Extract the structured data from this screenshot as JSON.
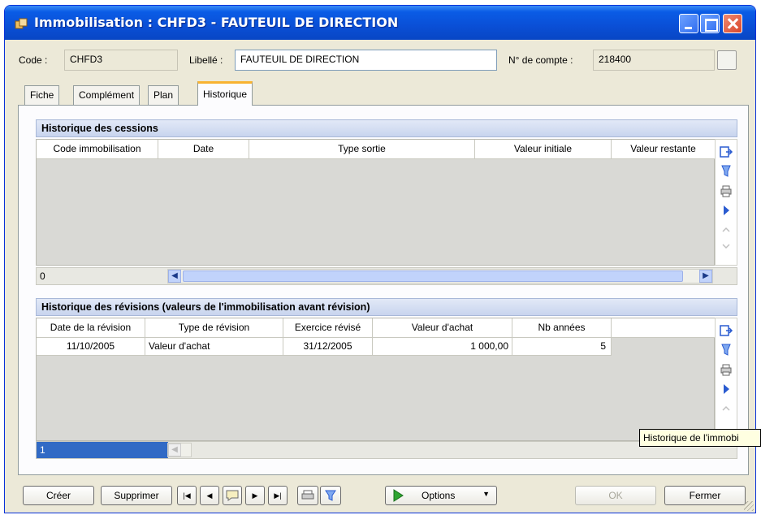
{
  "window": {
    "title": "Immobilisation : CHFD3 - FAUTEUIL DE DIRECTION"
  },
  "header": {
    "code_label": "Code :",
    "code_value": "CHFD3",
    "libelle_label": "Libellé :",
    "libelle_value": "FAUTEUIL DE DIRECTION",
    "compte_label": "N° de compte :",
    "compte_value": "218400"
  },
  "tabs": [
    {
      "label": "Fiche"
    },
    {
      "label": "Complément"
    },
    {
      "label": "Plan"
    },
    {
      "label": "Historique",
      "active": true
    }
  ],
  "cessions": {
    "title": "Historique des cessions",
    "columns": [
      "Code immobilisation",
      "Date",
      "Type sortie",
      "Valeur initiale",
      "Valeur restante"
    ],
    "rows": [],
    "count": "0"
  },
  "revisions": {
    "title": "Historique des révisions (valeurs de l'immobilisation avant révision)",
    "columns": [
      "Date de la révision",
      "Type de révision",
      "Exercice révisé",
      "Valeur d'achat",
      "Nb années"
    ],
    "rows": [
      {
        "date": "11/10/2005",
        "type": "Valeur d'achat",
        "exercice": "31/12/2005",
        "valeur": "1 000,00",
        "nb": "5"
      }
    ],
    "count": "1"
  },
  "tooltip": "Historique de l'immobi",
  "buttons": {
    "creer": "Créer",
    "supprimer": "Supprimer",
    "options": "Options",
    "ok": "OK",
    "fermer": "Fermer"
  },
  "icons": {
    "export": "export-icon",
    "filter": "filter-icon",
    "print": "print-icon",
    "play": "play-icon"
  },
  "colors": {
    "titlebar": "#0a4fd6",
    "accent_tab": "#f8b331",
    "selected_row": "#316ac5"
  }
}
